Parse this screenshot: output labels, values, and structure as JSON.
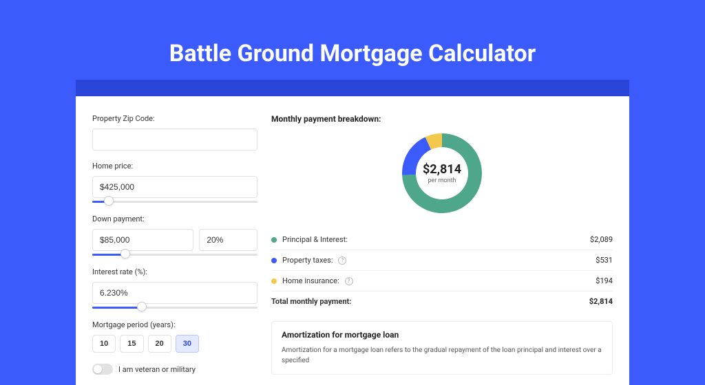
{
  "page_title": "Battle Ground Mortgage Calculator",
  "left": {
    "zip_label": "Property Zip Code:",
    "zip_value": "",
    "home_price_label": "Home price:",
    "home_price_value": "$425,000",
    "home_price_slider_pct": 10,
    "down_payment_label": "Down payment:",
    "down_payment_value": "$85,000",
    "down_payment_pct": "20%",
    "down_payment_slider_pct": 20,
    "interest_label": "Interest rate (%):",
    "interest_value": "6.230%",
    "interest_slider_pct": 30,
    "period_label": "Mortgage period (years):",
    "periods": [
      "10",
      "15",
      "20",
      "30"
    ],
    "period_active_index": 3,
    "veteran_label": "I am veteran or military",
    "veteran_on": false
  },
  "chart_data": {
    "type": "pie",
    "title": "Monthly payment breakdown:",
    "center_value": "$2,814",
    "center_sub": "per month",
    "series": [
      {
        "name": "Principal & Interest:",
        "value": 2089,
        "display": "$2,089",
        "color": "#4ea78b",
        "has_info": false
      },
      {
        "name": "Property taxes:",
        "value": 531,
        "display": "$531",
        "color": "#3b5bfd",
        "has_info": true
      },
      {
        "name": "Home insurance:",
        "value": 194,
        "display": "$194",
        "color": "#f2c94c",
        "has_info": true
      }
    ],
    "total_label": "Total monthly payment:",
    "total_display": "$2,814"
  },
  "amortization": {
    "title": "Amortization for mortgage loan",
    "body": "Amortization for a mortgage loan refers to the gradual repayment of the loan principal and interest over a specified"
  }
}
